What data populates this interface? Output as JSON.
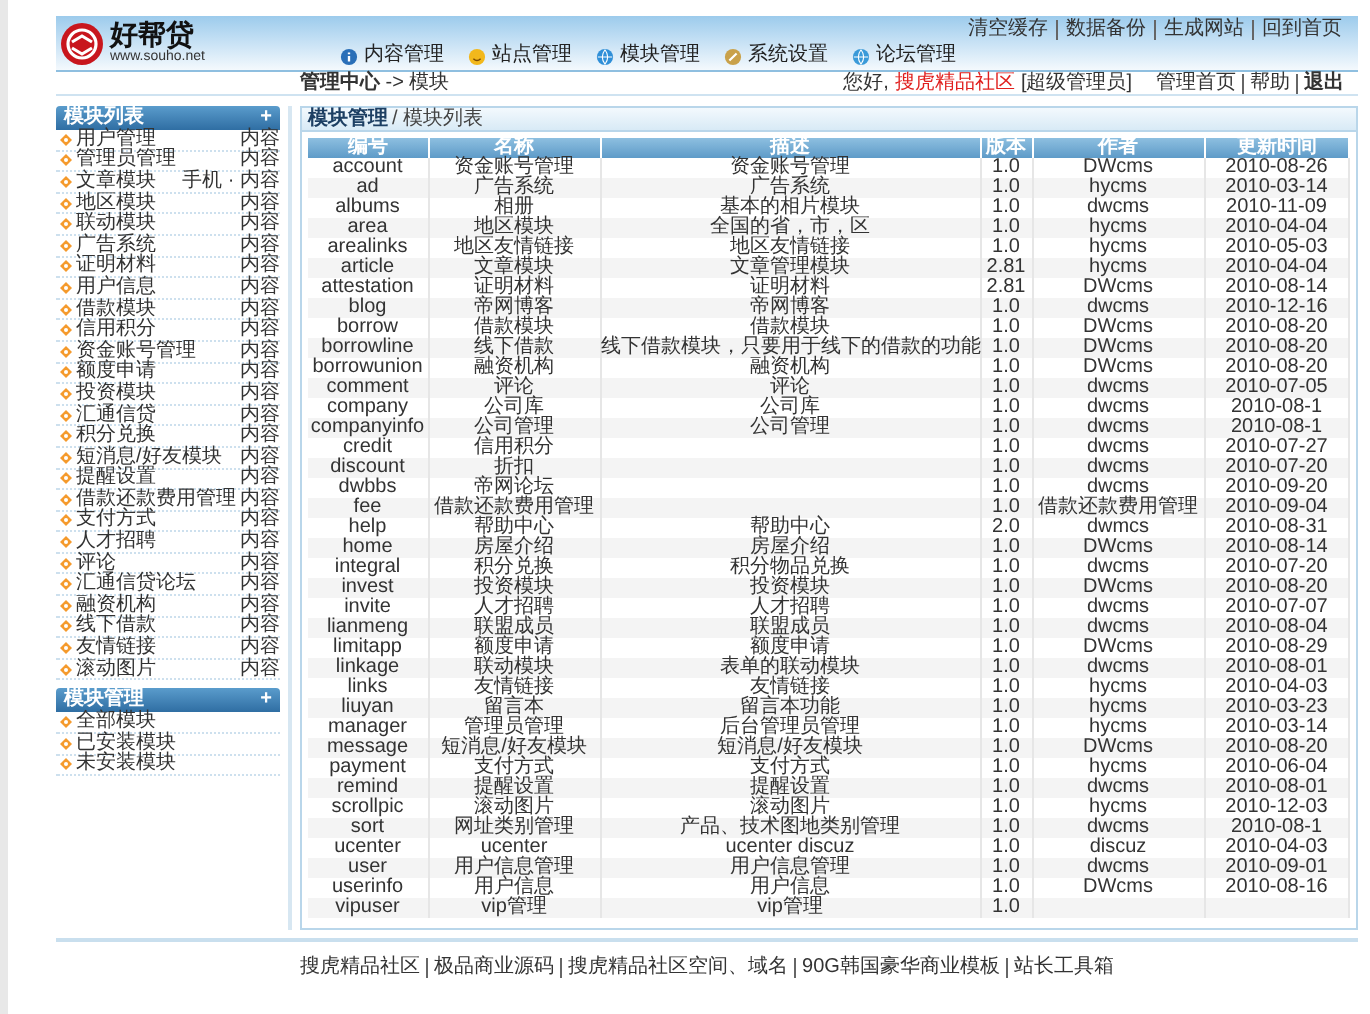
{
  "top_links": [
    "清空缓存",
    "数据备份",
    "生成网站",
    "回到首页"
  ],
  "logo": {
    "name": "好帮贷",
    "url": "www.souho.net"
  },
  "nav": [
    {
      "label": "内容管理"
    },
    {
      "label": "站点管理"
    },
    {
      "label": "模块管理"
    },
    {
      "label": "系统设置"
    },
    {
      "label": "论坛管理"
    }
  ],
  "breadcrumb": "**管理中心** -> 模块",
  "user_bar": {
    "greeting": "您好,",
    "user": "搜虎精品社区",
    "role": "[超级管理员]",
    "links": [
      "管理首页",
      "帮助",
      "退出"
    ]
  },
  "sidebar": [
    {
      "title": "模块列表",
      "toggle": "+",
      "items": [
        {
          "label": "用户管理",
          "action": "内容"
        },
        {
          "label": "管理员管理",
          "action": "内容"
        },
        {
          "label": "文章模块",
          "action": "手机 · 内容"
        },
        {
          "label": "地区模块",
          "action": "内容"
        },
        {
          "label": "联动模块",
          "action": "内容"
        },
        {
          "label": "广告系统",
          "action": "内容"
        },
        {
          "label": "证明材料",
          "action": "内容"
        },
        {
          "label": "用户信息",
          "action": "内容"
        },
        {
          "label": "借款模块",
          "action": "内容"
        },
        {
          "label": "信用积分",
          "action": "内容"
        },
        {
          "label": "资金账号管理",
          "action": "内容"
        },
        {
          "label": "额度申请",
          "action": "内容"
        },
        {
          "label": "投资模块",
          "action": "内容"
        },
        {
          "label": "汇通信贷",
          "action": "内容"
        },
        {
          "label": "积分兑换",
          "action": "内容"
        },
        {
          "label": "短消息/好友模块",
          "action": "内容"
        },
        {
          "label": "提醒设置",
          "action": "内容"
        },
        {
          "label": "借款还款费用管理",
          "action": "内容"
        },
        {
          "label": "支付方式",
          "action": "内容"
        },
        {
          "label": "人才招聘",
          "action": "内容"
        },
        {
          "label": "评论",
          "action": "内容"
        },
        {
          "label": "汇通信贷论坛",
          "action": "内容"
        },
        {
          "label": "融资机构",
          "action": "内容"
        },
        {
          "label": "线下借款",
          "action": "内容"
        },
        {
          "label": "友情链接",
          "action": "内容"
        },
        {
          "label": "滚动图片",
          "action": "内容"
        }
      ]
    },
    {
      "title": "模块管理",
      "toggle": "+",
      "items": [
        {
          "label": "全部模块"
        },
        {
          "label": "已安装模块"
        },
        {
          "label": "未安装模块"
        }
      ]
    }
  ],
  "panel": {
    "title": "模块管理",
    "subtitle": "/ 模块列表"
  },
  "table": {
    "columns": [
      "编号",
      "名称",
      "描述",
      "版本",
      "作者",
      "更新时间"
    ],
    "rows": [
      {
        "id": "account",
        "name": "资金账号管理",
        "description": "资金账号管理",
        "version": "1.0",
        "author": "DWcms",
        "updated": "2010-08-26"
      },
      {
        "id": "ad",
        "name": "广告系统",
        "description": "广告系统",
        "version": "1.0",
        "author": "hycms",
        "updated": "2010-03-14"
      },
      {
        "id": "albums",
        "name": "相册",
        "description": "基本的相片模块",
        "version": "1.0",
        "author": "dwcms",
        "updated": "2010-11-09"
      },
      {
        "id": "area",
        "name": "地区模块",
        "description": "全国的省，市，区",
        "version": "1.0",
        "author": "hycms",
        "updated": "2010-04-04"
      },
      {
        "id": "arealinks",
        "name": "地区友情链接",
        "description": "地区友情链接",
        "version": "1.0",
        "author": "hycms",
        "updated": "2010-05-03"
      },
      {
        "id": "article",
        "name": "文章模块",
        "description": "文章管理模块",
        "version": "2.81",
        "author": "hycms",
        "updated": "2010-04-04"
      },
      {
        "id": "attestation",
        "name": "证明材料",
        "description": "证明材料",
        "version": "2.81",
        "author": "DWcms",
        "updated": "2010-08-14"
      },
      {
        "id": "blog",
        "name": "帝网博客",
        "description": "帝网博客",
        "version": "1.0",
        "author": "dwcms",
        "updated": "2010-12-16"
      },
      {
        "id": "borrow",
        "name": "借款模块",
        "description": "借款模块",
        "version": "1.0",
        "author": "DWcms",
        "updated": "2010-08-20"
      },
      {
        "id": "borrowline",
        "name": "线下借款",
        "description": "线下借款模块，只要用于线下的借款的功能",
        "version": "1.0",
        "author": "DWcms",
        "updated": "2010-08-20"
      },
      {
        "id": "borrowunion",
        "name": "融资机构",
        "description": "融资机构",
        "version": "1.0",
        "author": "DWcms",
        "updated": "2010-08-20"
      },
      {
        "id": "comment",
        "name": "评论",
        "description": "评论",
        "version": "1.0",
        "author": "dwcms",
        "updated": "2010-07-05"
      },
      {
        "id": "company",
        "name": "公司库",
        "description": "公司库",
        "version": "1.0",
        "author": "dwcms",
        "updated": "2010-08-1"
      },
      {
        "id": "companyinfo",
        "name": "公司管理",
        "description": "公司管理",
        "version": "1.0",
        "author": "dwcms",
        "updated": "2010-08-1"
      },
      {
        "id": "credit",
        "name": "信用积分",
        "version": "1.0",
        "author": "dwcms",
        "updated": "2010-07-27"
      },
      {
        "id": "discount",
        "name": "折扣",
        "version": "1.0",
        "author": "dwcms",
        "updated": "2010-07-20"
      },
      {
        "id": "dwbbs",
        "name": "帝网论坛",
        "version": "1.0",
        "author": "dwcms",
        "updated": "2010-09-20"
      },
      {
        "id": "fee",
        "name": "借款还款费用管理",
        "version": "1.0",
        "author": "借款还款费用管理",
        "updated": "2010-09-04"
      },
      {
        "id": "help",
        "name": "帮助中心",
        "description": "帮助中心",
        "version": "2.0",
        "author": "dwmcs",
        "updated": "2010-08-31"
      },
      {
        "id": "home",
        "name": "房屋介绍",
        "description": "房屋介绍",
        "version": "1.0",
        "author": "DWcms",
        "updated": "2010-08-14"
      },
      {
        "id": "integral",
        "name": "积分兑换",
        "description": "积分物品兑换",
        "version": "1.0",
        "author": "dwcms",
        "updated": "2010-07-20"
      },
      {
        "id": "invest",
        "name": "投资模块",
        "description": "投资模块",
        "version": "1.0",
        "author": "DWcms",
        "updated": "2010-08-20"
      },
      {
        "id": "invite",
        "name": "人才招聘",
        "description": "人才招聘",
        "version": "1.0",
        "author": "dwcms",
        "updated": "2010-07-07"
      },
      {
        "id": "lianmeng",
        "name": "联盟成员",
        "description": "联盟成员",
        "version": "1.0",
        "author": "dwcms",
        "updated": "2010-08-04"
      },
      {
        "id": "limitapp",
        "name": "额度申请",
        "description": "额度申请",
        "version": "1.0",
        "author": "DWcms",
        "updated": "2010-08-29"
      },
      {
        "id": "linkage",
        "name": "联动模块",
        "description": "表单的联动模块",
        "version": "1.0",
        "author": "dwcms",
        "updated": "2010-08-01"
      },
      {
        "id": "links",
        "name": "友情链接",
        "description": "友情链接",
        "version": "1.0",
        "author": "hycms",
        "updated": "2010-04-03"
      },
      {
        "id": "liuyan",
        "name": "留言本",
        "description": "留言本功能",
        "version": "1.0",
        "author": "hycms",
        "updated": "2010-03-23"
      },
      {
        "id": "manager",
        "name": "管理员管理",
        "description": "后台管理员管理",
        "version": "1.0",
        "author": "hycms",
        "updated": "2010-03-14"
      },
      {
        "id": "message",
        "name": "短消息/好友模块",
        "description": "短消息/好友模块",
        "version": "1.0",
        "author": "DWcms",
        "updated": "2010-08-20"
      },
      {
        "id": "payment",
        "name": "支付方式",
        "description": "支付方式",
        "version": "1.0",
        "author": "hycms",
        "updated": "2010-06-04"
      },
      {
        "id": "remind",
        "name": "提醒设置",
        "description": "提醒设置",
        "version": "1.0",
        "author": "dwcms",
        "updated": "2010-08-01"
      },
      {
        "id": "scrollpic",
        "name": "滚动图片",
        "description": "滚动图片",
        "version": "1.0",
        "author": "hycms",
        "updated": "2010-12-03"
      },
      {
        "id": "sort",
        "name": "网址类别管理",
        "description": "产品、技术图地类别管理",
        "version": "1.0",
        "author": "dwcms",
        "updated": "2010-08-1"
      },
      {
        "id": "ucenter",
        "name": "ucenter",
        "description": "ucenter discuz",
        "version": "1.0",
        "author": "discuz",
        "updated": "2010-04-03"
      },
      {
        "id": "user",
        "name": "用户信息管理",
        "description": "用户信息管理",
        "version": "1.0",
        "author": "dwcms",
        "updated": "2010-09-01"
      },
      {
        "id": "userinfo",
        "name": "用户信息",
        "description": "用户信息",
        "version": "1.0",
        "author": "DWcms",
        "updated": "2010-08-16"
      },
      {
        "id": "vipuser",
        "name": "vip管理",
        "description": "vip管理",
        "version": "1.0"
      }
    ]
  },
  "footer": [
    "搜虎精品社区",
    "极品商业源码",
    "搜虎精品社区空间、域名",
    "90G韩国豪华商业模板",
    "站长工具箱"
  ]
}
